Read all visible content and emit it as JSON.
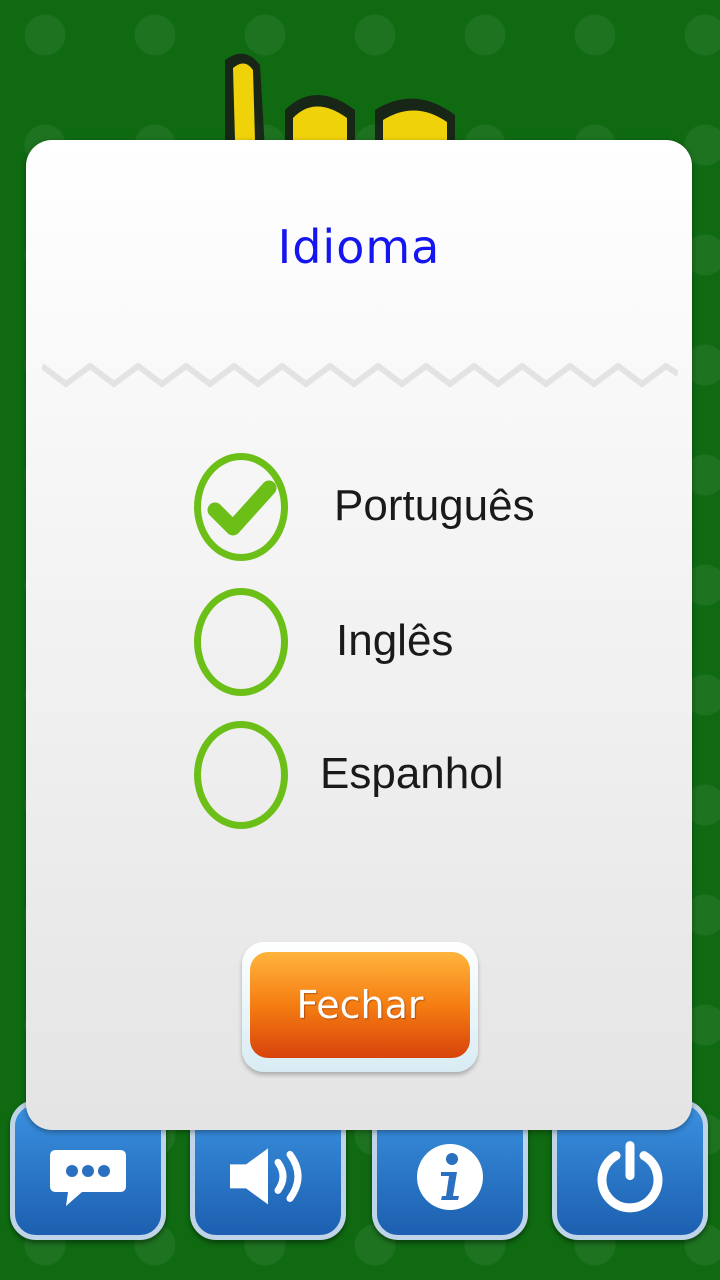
{
  "dialog": {
    "title": "Idioma",
    "options": [
      {
        "label": "Português",
        "selected": true
      },
      {
        "label": "Inglês",
        "selected": false
      },
      {
        "label": "Espanhol",
        "selected": false
      }
    ],
    "close_label": "Fechar"
  },
  "bottom_bar": {
    "buttons": [
      {
        "icon": "chat-icon"
      },
      {
        "icon": "speaker-icon"
      },
      {
        "icon": "info-icon"
      },
      {
        "icon": "power-icon"
      }
    ]
  },
  "colors": {
    "background": "#0f6a12",
    "title": "#1515f0",
    "radio": "#6bbf17",
    "button_orange": "#f57d12",
    "tile_blue": "#2a78cc"
  }
}
